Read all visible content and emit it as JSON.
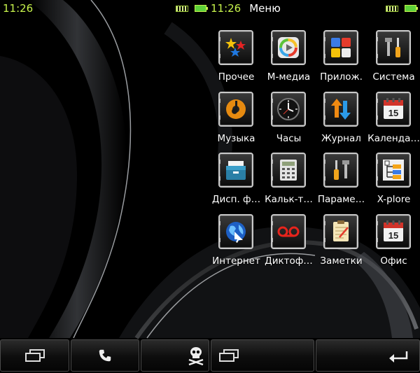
{
  "status_left": {
    "time": "11:26"
  },
  "status_right": {
    "time": "11:26",
    "title": "Меню"
  },
  "apps": [
    {
      "label": "Прочее",
      "icon": "stars-icon"
    },
    {
      "label": "M-медиа",
      "icon": "media-icon"
    },
    {
      "label": "Прилож.",
      "icon": "apps-icon"
    },
    {
      "label": "Система",
      "icon": "tools-icon"
    },
    {
      "label": "Музыка",
      "icon": "music-disc-icon"
    },
    {
      "label": "Часы",
      "icon": "clock-icon"
    },
    {
      "label": "Журнал",
      "icon": "up-down-arrows-icon"
    },
    {
      "label": "Календа…",
      "icon": "calendar-icon"
    },
    {
      "label": "Дисп. ф…",
      "icon": "file-cabinet-icon"
    },
    {
      "label": "Кальк-т…",
      "icon": "calculator-icon"
    },
    {
      "label": "Параме…",
      "icon": "screwdriver-icon"
    },
    {
      "label": "X-plore",
      "icon": "tree-icon"
    },
    {
      "label": "Интернет",
      "icon": "globe-icon"
    },
    {
      "label": "Диктоф…",
      "icon": "voicemail-icon"
    },
    {
      "label": "Заметки",
      "icon": "notepad-icon"
    },
    {
      "label": "Офис",
      "icon": "calendar-icon"
    }
  ],
  "calendar_day": "15",
  "softkeys": [
    {
      "icon": "multitask-icon"
    },
    {
      "icon": "phone-icon"
    },
    {
      "icon": "skull-icon"
    },
    {
      "icon": "multitask-icon"
    },
    {
      "icon": "back-arrow-icon"
    }
  ],
  "colors": {
    "status_time": "#c6f24c",
    "background": "#000000"
  }
}
